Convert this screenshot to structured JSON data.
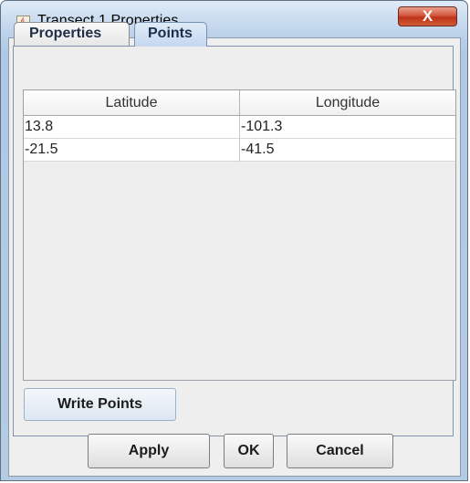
{
  "window": {
    "title": "Transect 1 Properties",
    "close_label": "X"
  },
  "tabs": [
    {
      "label": "Properties",
      "selected": false
    },
    {
      "label": "Points",
      "selected": true
    }
  ],
  "table": {
    "columns": [
      "Latitude",
      "Longitude"
    ],
    "rows": [
      [
        "13.8",
        "-101.3"
      ],
      [
        "-21.5",
        "-41.5"
      ]
    ]
  },
  "buttons": {
    "write_points": "Write Points",
    "apply": "Apply",
    "ok": "OK",
    "cancel": "Cancel"
  },
  "icons": {
    "app_icon": "java-cup-icon",
    "close_icon": "close-icon"
  },
  "colors": {
    "title_bar": "#b9d0ea",
    "close_button": "#c8452a",
    "selected_tab": "#c5d8ef",
    "panel_bg": "#eeeeee"
  }
}
